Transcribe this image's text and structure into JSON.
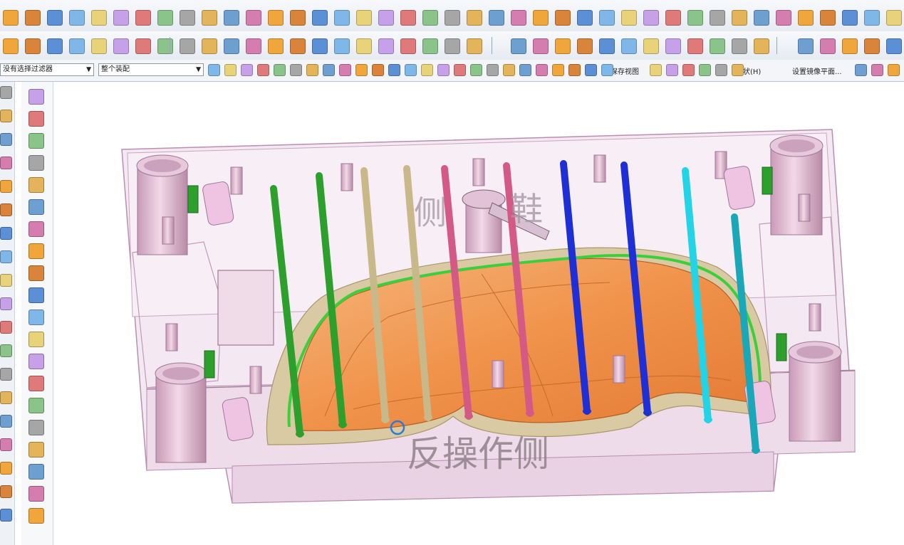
{
  "toolbar": {
    "selection_filter": "没有选择过滤器",
    "assembly_scope": "整个装配",
    "save_view_label": "保存视图",
    "shape_label": "形状(H)",
    "set_mirror_plane_label": "设置镜像平面..."
  },
  "model": {
    "label_top": "侧",
    "label_top_right": "鞋",
    "label_bottom": "反操作侧"
  },
  "colors": {
    "plate": "#f4e6f1",
    "plate_edge": "#b88fb0",
    "core": "#f2a25e",
    "core_rim": "#d8c9a2",
    "pin_pink": "#e3b3cd",
    "water_green": "#2c9f2c",
    "ejector_tan": "#c9b98a",
    "rod_magenta": "#d45a86",
    "rod_blue": "#1e2fd6",
    "rod_cyan": "#22d4e6",
    "rod_teal": "#1aa7b8"
  }
}
